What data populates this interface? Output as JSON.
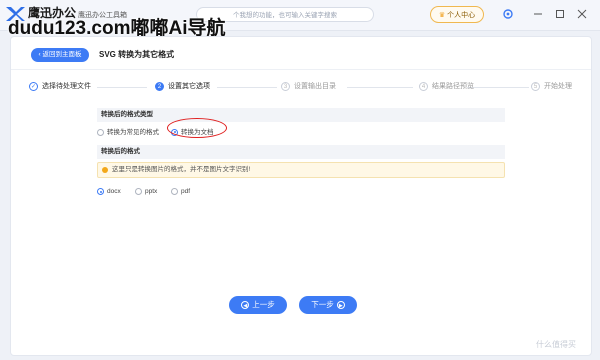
{
  "titlebar": {
    "brand": "鹰迅办公",
    "app_subtitle": "鹰迅办公工具箱",
    "search_placeholder": "个我想的功能，也可输入关键字搜索",
    "user_center": "个人中心",
    "overlay_watermark": "dudu123.com嘟嘟Ai导航"
  },
  "header": {
    "back_label": "返回到主面板",
    "title": "SVG 转换为其它格式"
  },
  "steps": [
    {
      "label": "选择待处理文件",
      "state": "done",
      "num": "✓"
    },
    {
      "label": "设置其它选项",
      "state": "active",
      "num": "2"
    },
    {
      "label": "设置输出目录",
      "state": "todo",
      "num": "3"
    },
    {
      "label": "结果路径预览",
      "state": "todo",
      "num": "4"
    },
    {
      "label": "开始处理",
      "state": "todo",
      "num": "5"
    }
  ],
  "format_type": {
    "heading": "转换后的格式类型",
    "options": [
      {
        "label": "转换为常见的格式",
        "selected": false
      },
      {
        "label": "转换为文档",
        "selected": true
      }
    ]
  },
  "format": {
    "heading": "转换后的格式",
    "notice": "这里只是转换图片的格式，并不是图片文字识别!",
    "options": [
      {
        "label": "docx",
        "selected": true
      },
      {
        "label": "pptx",
        "selected": false
      },
      {
        "label": "pdf",
        "selected": false
      }
    ]
  },
  "footer": {
    "prev": "上一步",
    "next": "下一步"
  },
  "corner_watermark": "什么值得买",
  "colors": {
    "accent": "#3d7bf5",
    "highlight": "#e02020",
    "notice_bg": "#fff8e6"
  }
}
